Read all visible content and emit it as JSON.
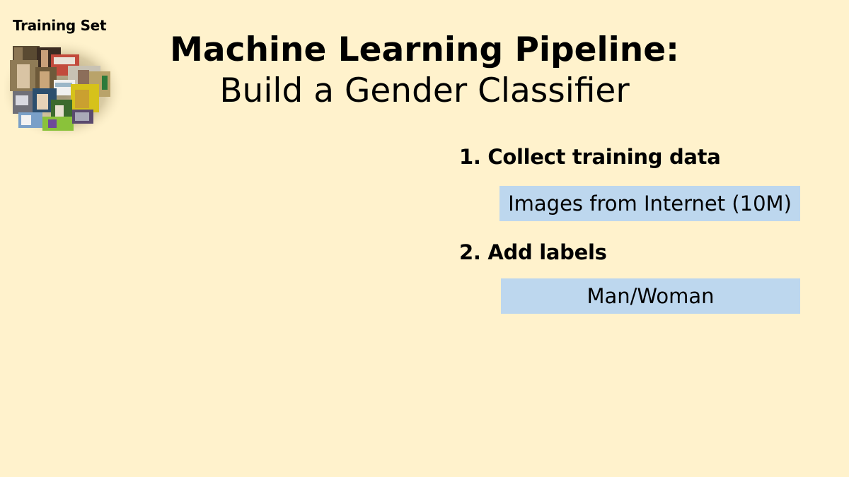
{
  "slide": {
    "training_set_label": "Training Set",
    "title_line1": "Machine Learning Pipeline:",
    "title_line2": "Build a Gender Classifier",
    "steps": [
      {
        "heading": "1. Collect training data",
        "box_text": "Images from Internet (10M)"
      },
      {
        "heading": "2. Add labels",
        "box_text": "Man/Woman"
      }
    ]
  },
  "colors": {
    "background": "#fff2cc",
    "box": "#bdd7ee"
  }
}
